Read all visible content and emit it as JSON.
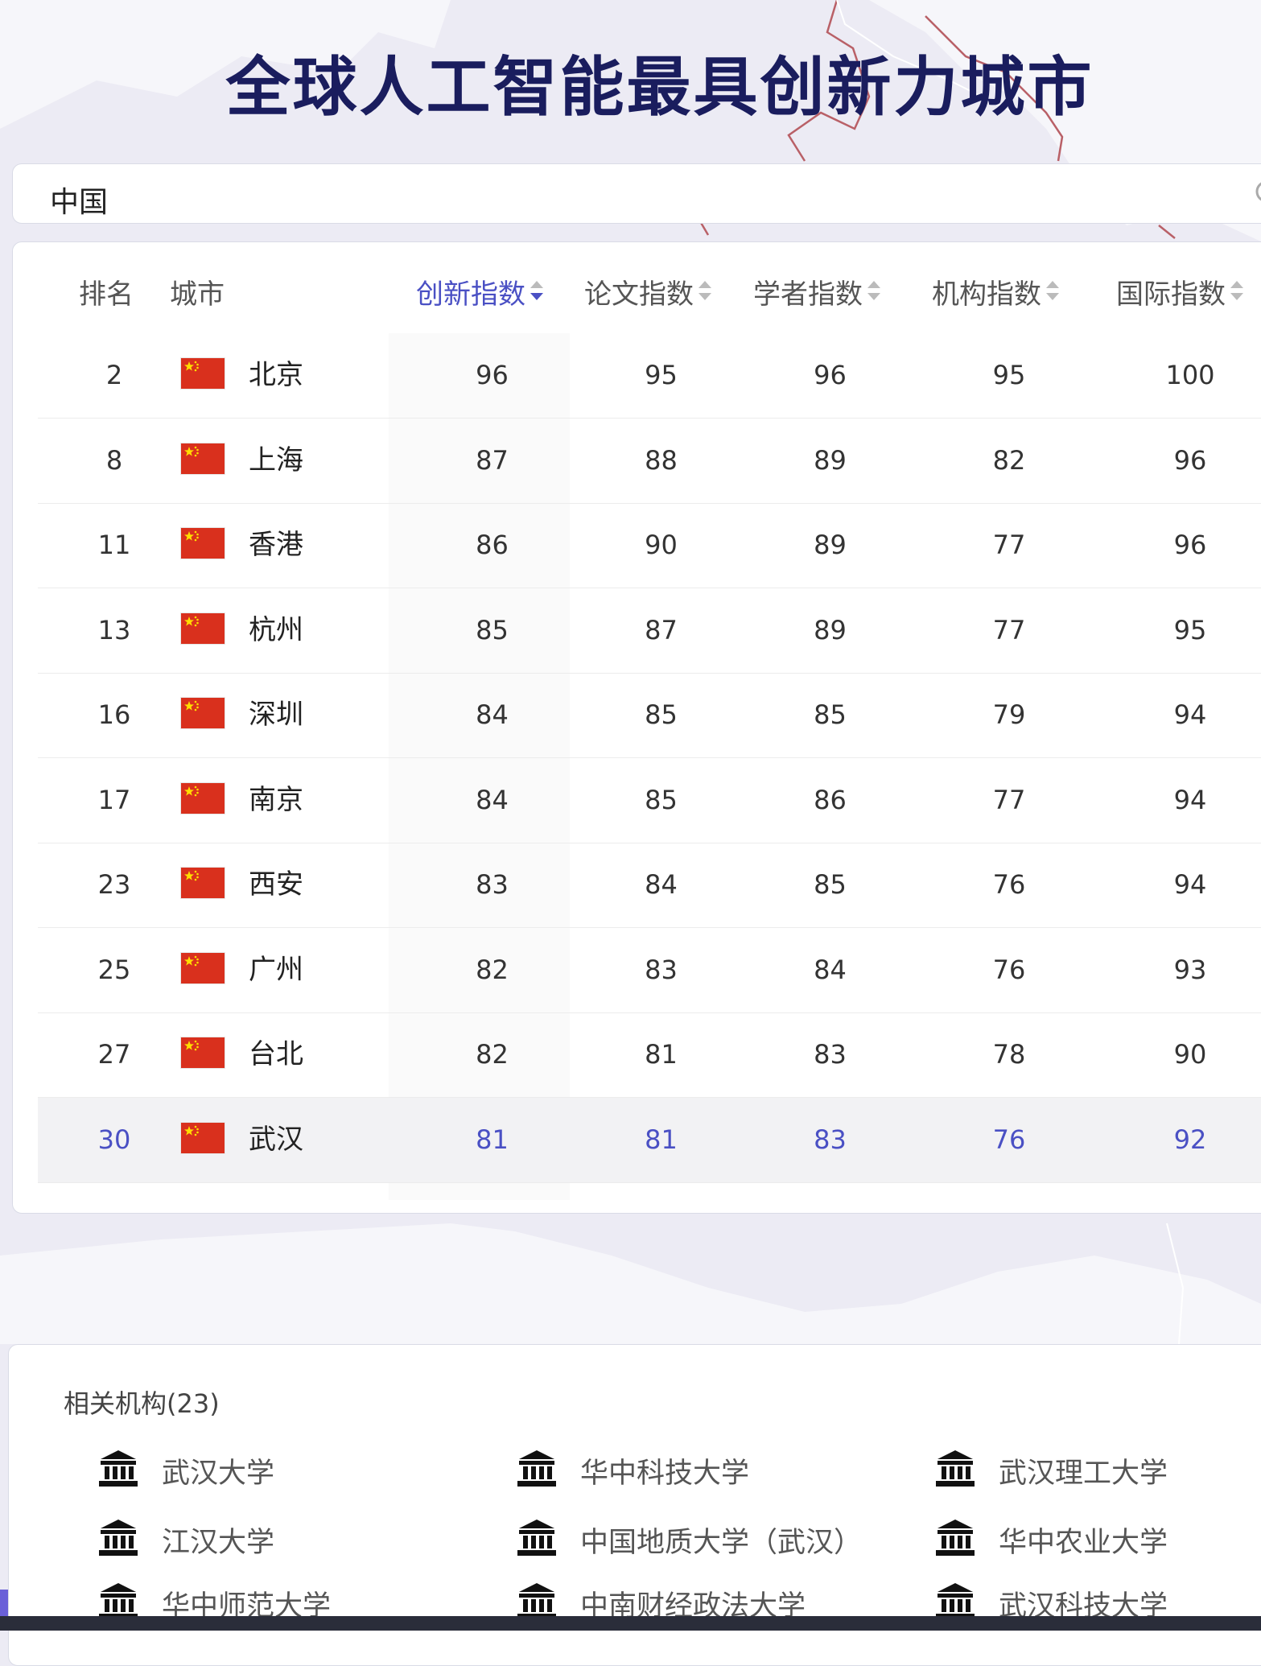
{
  "header": {
    "title": "全球人工智能最具创新力城市"
  },
  "search": {
    "value": "中国"
  },
  "table": {
    "columns": [
      "排名",
      "城市",
      "创新指数",
      "论文指数",
      "学者指数",
      "机构指数",
      "国际指数"
    ],
    "sorted_column": "创新指数",
    "rows": [
      {
        "rank": "2",
        "city": "北京",
        "innovation": "96",
        "paper": "95",
        "scholar": "96",
        "institution": "95",
        "international": "100"
      },
      {
        "rank": "8",
        "city": "上海",
        "innovation": "87",
        "paper": "88",
        "scholar": "89",
        "institution": "82",
        "international": "96"
      },
      {
        "rank": "11",
        "city": "香港",
        "innovation": "86",
        "paper": "90",
        "scholar": "89",
        "institution": "77",
        "international": "96"
      },
      {
        "rank": "13",
        "city": "杭州",
        "innovation": "85",
        "paper": "87",
        "scholar": "89",
        "institution": "77",
        "international": "95"
      },
      {
        "rank": "16",
        "city": "深圳",
        "innovation": "84",
        "paper": "85",
        "scholar": "85",
        "institution": "79",
        "international": "94"
      },
      {
        "rank": "17",
        "city": "南京",
        "innovation": "84",
        "paper": "85",
        "scholar": "86",
        "institution": "77",
        "international": "94"
      },
      {
        "rank": "23",
        "city": "西安",
        "innovation": "83",
        "paper": "84",
        "scholar": "85",
        "institution": "76",
        "international": "94"
      },
      {
        "rank": "25",
        "city": "广州",
        "innovation": "82",
        "paper": "83",
        "scholar": "84",
        "institution": "76",
        "international": "93"
      },
      {
        "rank": "27",
        "city": "台北",
        "innovation": "82",
        "paper": "81",
        "scholar": "83",
        "institution": "78",
        "international": "90"
      },
      {
        "rank": "30",
        "city": "武汉",
        "innovation": "81",
        "paper": "81",
        "scholar": "83",
        "institution": "76",
        "international": "92",
        "highlighted": true
      }
    ]
  },
  "institutions": {
    "title": "相关机构(23)",
    "items": [
      "武汉大学",
      "华中科技大学",
      "武汉理工大学",
      "江汉大学",
      "中国地质大学（武汉）",
      "华中农业大学",
      "华中师范大学",
      "中南财经政法大学",
      "武汉科技大学"
    ]
  },
  "colors": {
    "accent": "#4a50c4",
    "title": "#1a1d5e",
    "flag_red": "#d9301d",
    "flag_star": "#ffde00"
  }
}
